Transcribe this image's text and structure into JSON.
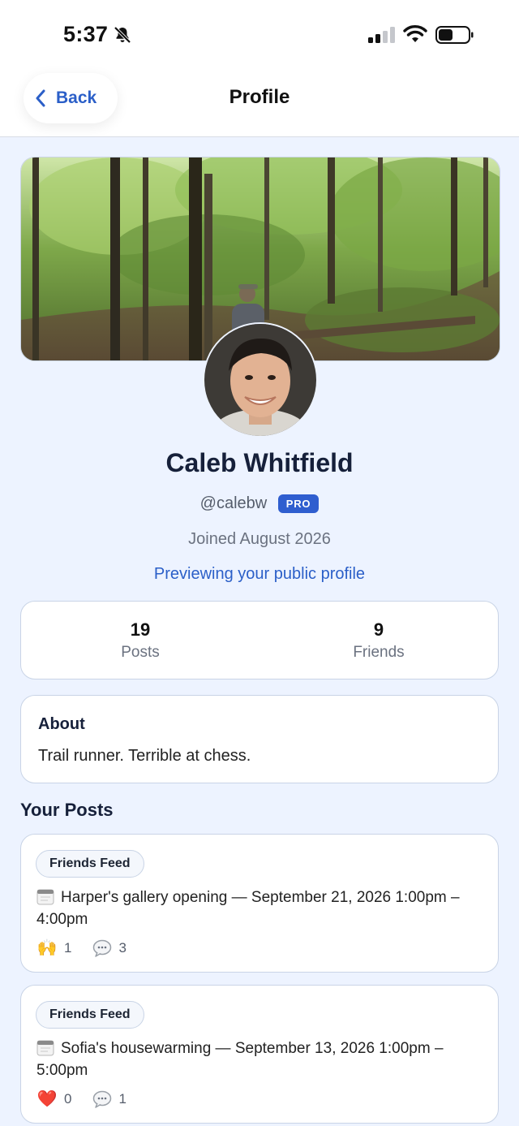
{
  "status_bar": {
    "time": "5:37"
  },
  "nav": {
    "back_label": "Back",
    "title": "Profile"
  },
  "profile": {
    "name": "Caleb Whitfield",
    "handle": "@calebw",
    "badge": "PRO",
    "joined": "Joined August 2026",
    "preview_link": "Previewing your public profile"
  },
  "stats": [
    {
      "value": "19",
      "label": "Posts"
    },
    {
      "value": "9",
      "label": "Friends"
    }
  ],
  "about": {
    "title": "About",
    "text": "Trail runner. Terrible at chess."
  },
  "posts_section_title": "Your Posts",
  "posts": [
    {
      "feed": "Friends Feed",
      "text": "Harper's gallery opening — September 21, 2026 1:00pm – 4:00pm",
      "reaction_emoji": "🙌",
      "reaction_count": "1",
      "comment_count": "3"
    },
    {
      "feed": "Friends Feed",
      "text": "Sofia's housewarming — September 13, 2026 1:00pm – 5:00pm",
      "reaction_emoji": "❤️",
      "reaction_count": "0",
      "comment_count": "1"
    }
  ],
  "colors": {
    "accent": "#2b5fc8",
    "badge": "#2f5ecf",
    "background": "#edf3ff"
  }
}
